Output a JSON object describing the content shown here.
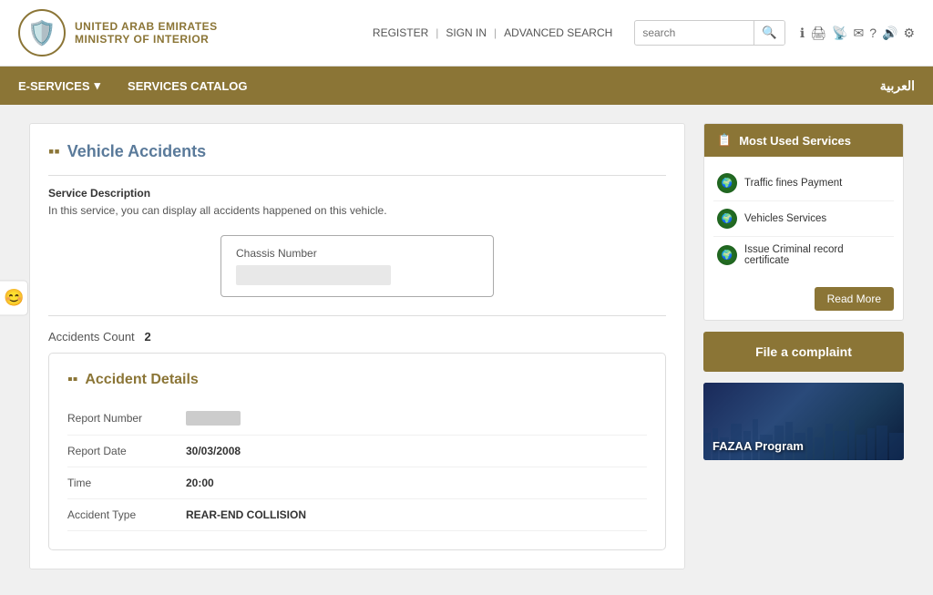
{
  "header": {
    "org_line1": "UNITED ARAB EMIRATES",
    "org_line2": "MINISTRY OF INTERIOR",
    "nav": {
      "register": "REGISTER",
      "sign_in": "SIGN IN",
      "advanced_search": "ADVANCED SEARCH"
    },
    "search_placeholder": "search",
    "icons": [
      "ℹ",
      "🖨",
      "📡",
      "✉",
      "?",
      "🔊",
      "⚙"
    ]
  },
  "navbar": {
    "e_services": "E-SERVICES",
    "services_catalog": "SERVICES CATALOG",
    "arabic": "العربية"
  },
  "page": {
    "title": "Vehicle Accidents",
    "title_icon": "▪▪",
    "service_description_label": "Service Description",
    "service_description_text": "In this service, you can display all accidents happened on this vehicle.",
    "chassis_label": "Chassis Number",
    "accidents_count_label": "Accidents Count",
    "accidents_count_value": "2"
  },
  "accident_details": {
    "title": "Accident Details",
    "fields": [
      {
        "label": "Report Number",
        "value": "",
        "blurred": true
      },
      {
        "label": "Report Date",
        "value": "30/03/2008",
        "blurred": false
      },
      {
        "label": "Time",
        "value": "20:00",
        "blurred": false
      },
      {
        "label": "Accident Type",
        "value": "REAR-END COLLISION",
        "blurred": false
      }
    ]
  },
  "sidebar": {
    "most_used_title": "Most Used Services",
    "services": [
      {
        "label": "Traffic fines Payment"
      },
      {
        "label": "Vehicles Services"
      },
      {
        "label": "Issue Criminal record certificate"
      }
    ],
    "read_more": "Read More",
    "complaint_btn": "File a complaint",
    "fazaa_label": "FAZAA Program"
  }
}
